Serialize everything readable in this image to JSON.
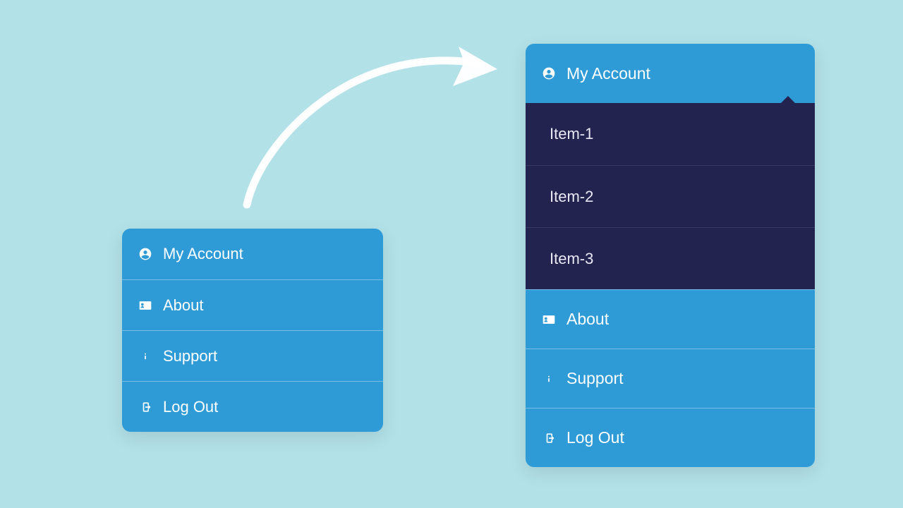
{
  "colors": {
    "background": "#b2e1e8",
    "menu_bg": "#2e9bd6",
    "submenu_bg": "#23234f",
    "text": "#ffffff"
  },
  "menu_collapsed": {
    "items": [
      {
        "label": "My Account",
        "icon": "user-circle-icon"
      },
      {
        "label": "About",
        "icon": "id-card-icon"
      },
      {
        "label": "Support",
        "icon": "info-icon"
      },
      {
        "label": "Log Out",
        "icon": "sign-out-icon"
      }
    ]
  },
  "menu_expanded": {
    "header": {
      "label": "My Account",
      "icon": "user-circle-icon"
    },
    "submenu": [
      {
        "label": "Item-1"
      },
      {
        "label": "Item-2"
      },
      {
        "label": "Item-3"
      }
    ],
    "items": [
      {
        "label": "About",
        "icon": "id-card-icon"
      },
      {
        "label": "Support",
        "icon": "info-icon"
      },
      {
        "label": "Log Out",
        "icon": "sign-out-icon"
      }
    ]
  }
}
